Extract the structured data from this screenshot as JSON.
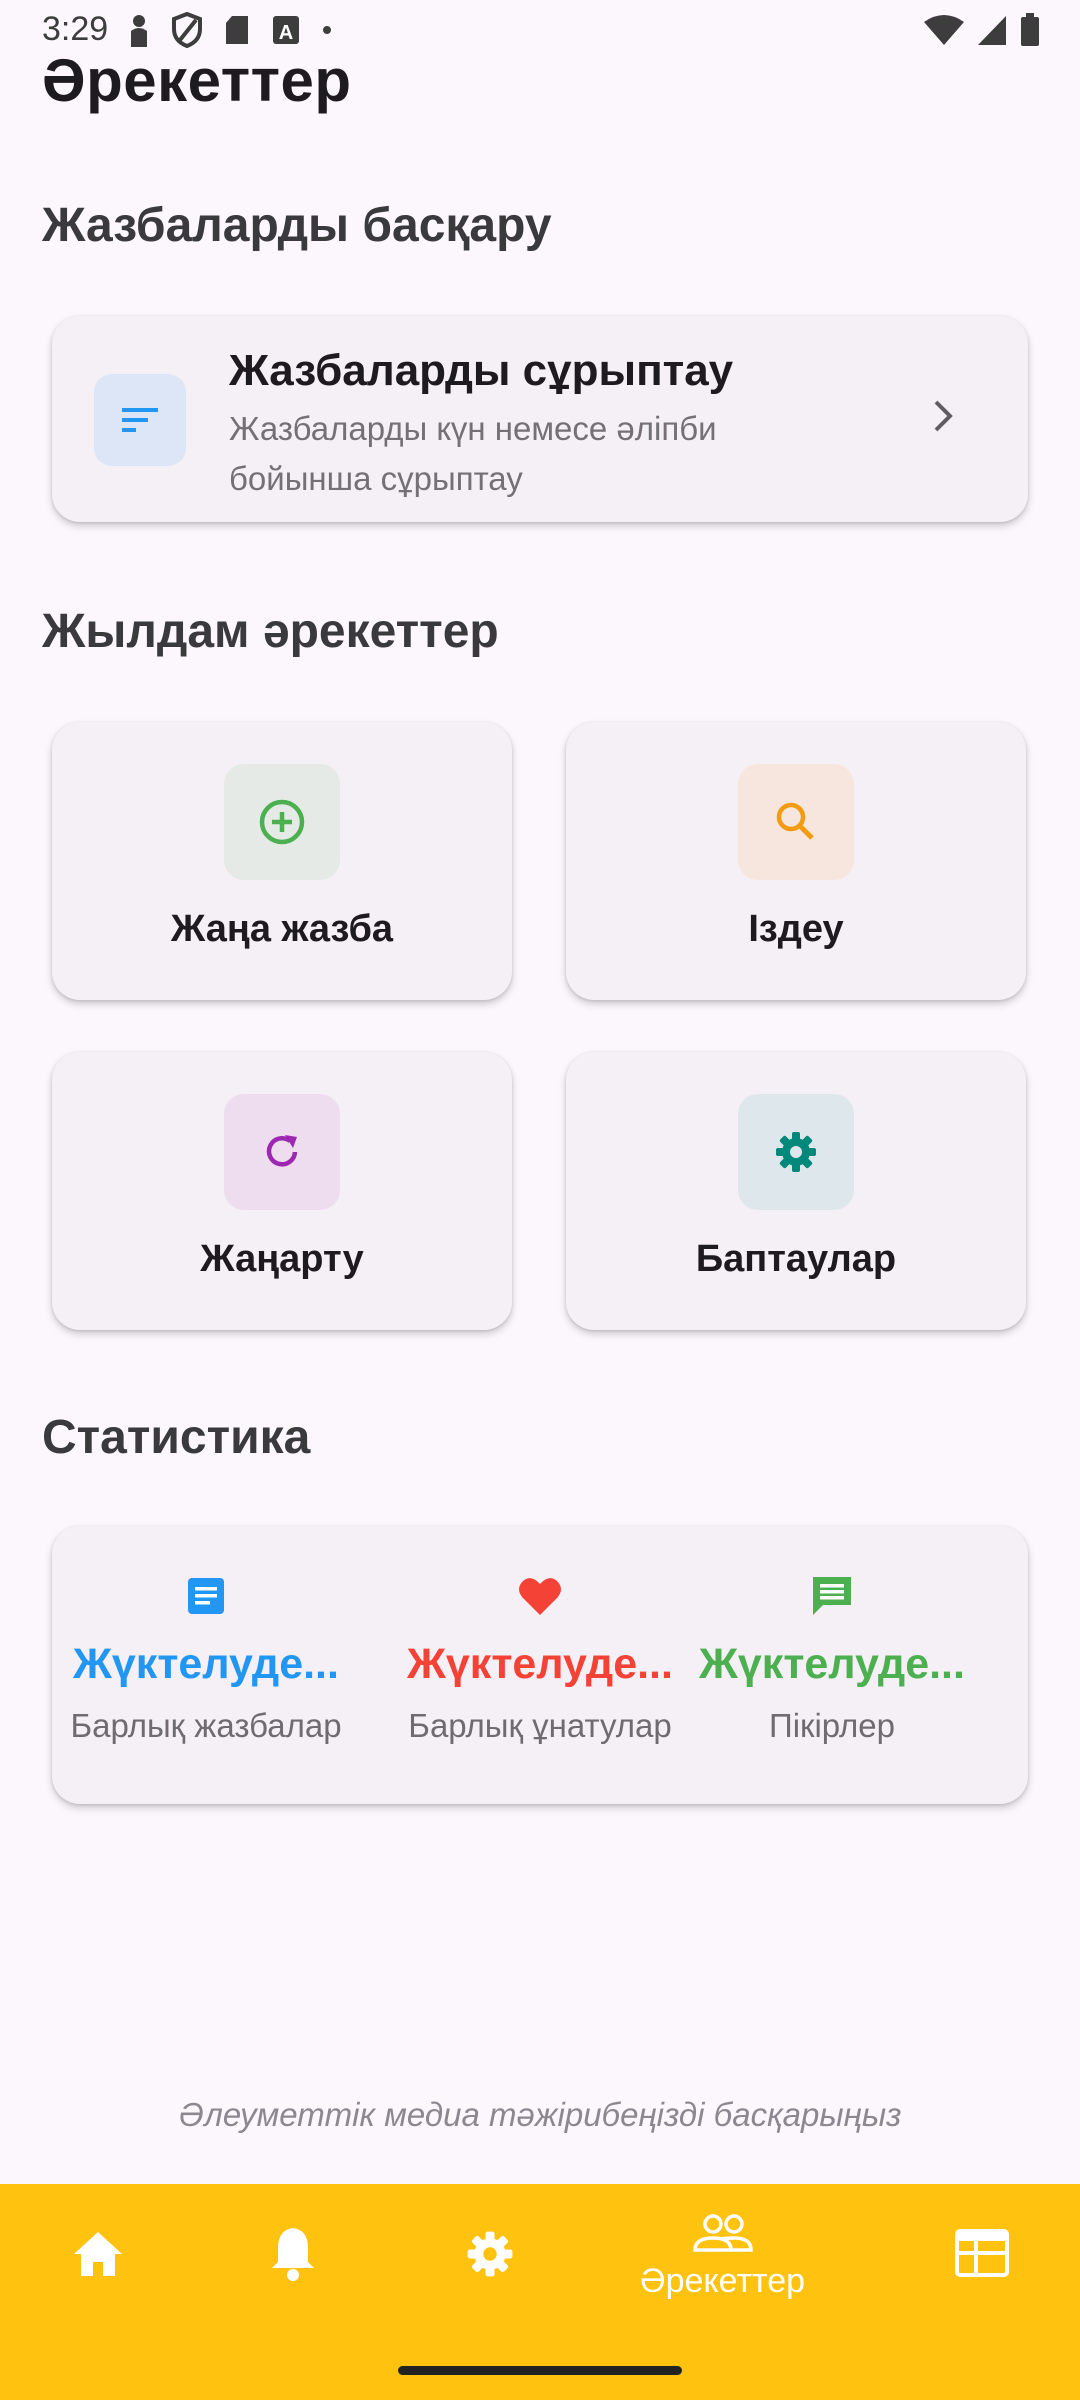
{
  "status_bar": {
    "time": "3:29"
  },
  "header": {
    "title": "Әрекеттер"
  },
  "sections": {
    "manage": "Жазбаларды басқару",
    "quick": "Жылдам әрекеттер",
    "stats": "Статистика"
  },
  "sort_card": {
    "title": "Жазбаларды сұрыптау",
    "description": "Жазбаларды күн немесе әліпби бойынша сұрыптау",
    "icon": "sort-icon"
  },
  "quick_actions": [
    {
      "label": "Жаңа жазба",
      "icon": "add-circle-icon",
      "icon_color": "#4CAF50",
      "bg": "#E5EAE6"
    },
    {
      "label": "Іздеу",
      "icon": "search-icon",
      "icon_color": "#F39C12",
      "bg": "#F7E6DE"
    },
    {
      "label": "Жаңарту",
      "icon": "refresh-icon",
      "icon_color": "#9C27B0",
      "bg": "#EEDCEF"
    },
    {
      "label": "Баптаулар",
      "icon": "gear-icon",
      "icon_color": "#00897B",
      "bg": "#DEE8EC"
    }
  ],
  "stats": [
    {
      "value": "Жүктелуде...",
      "label": "Барлық жазбалар",
      "color": "#2196F3",
      "icon": "article-icon"
    },
    {
      "value": "Жүктелуде...",
      "label": "Барлық ұнатулар",
      "color": "#F44336",
      "icon": "heart-icon"
    },
    {
      "value": "Жүктелуде...",
      "label": "Пікірлер",
      "color": "#4CAF50",
      "icon": "comment-icon"
    }
  ],
  "footer": "Әлеуметтік медиа тәжірибеңізді басқарыңыз",
  "bottom_nav": {
    "active_label": "Әрекеттер",
    "items": [
      "home-icon",
      "bell-icon",
      "gear-icon",
      "people-icon",
      "table-icon"
    ],
    "background": "#FFC20E"
  }
}
